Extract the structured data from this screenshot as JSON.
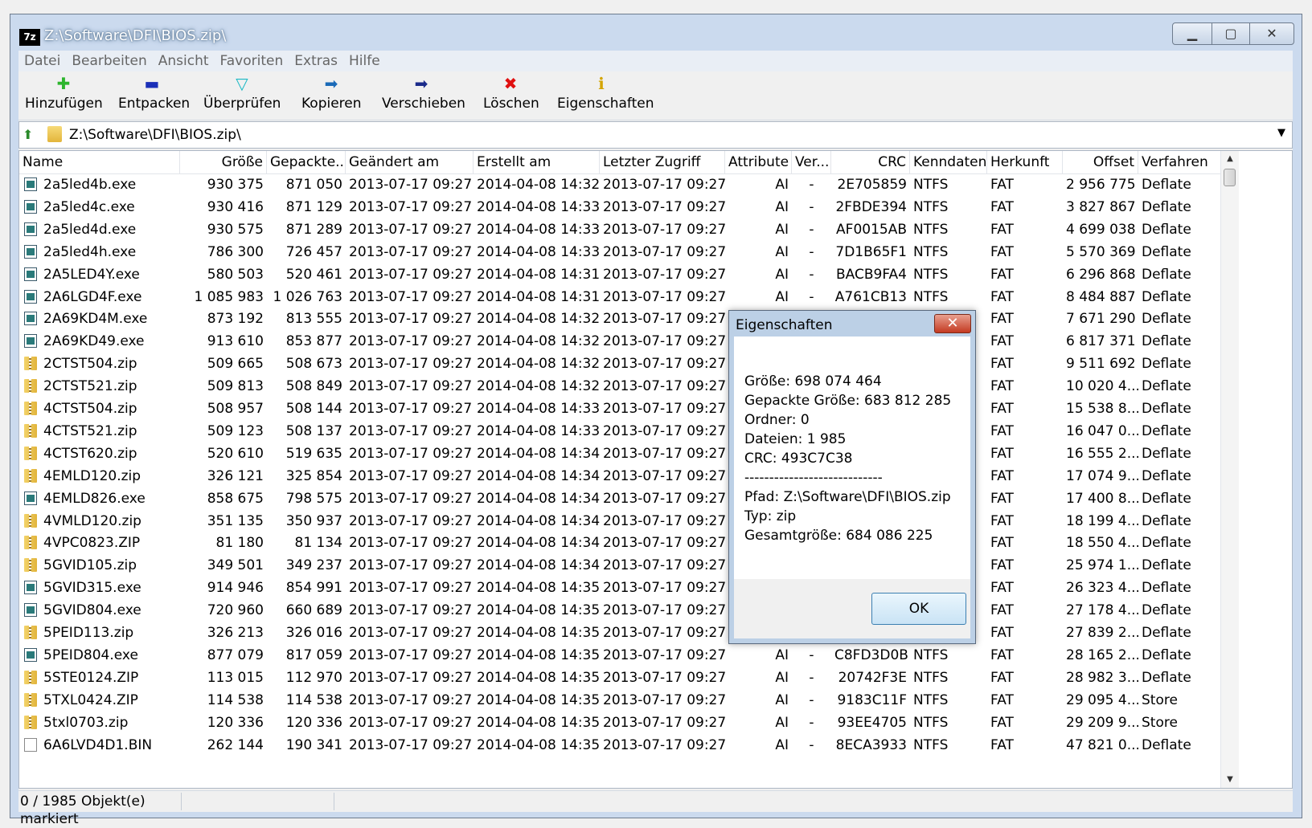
{
  "window": {
    "title": "Z:\\Software\\DFI\\BIOS.zip\\"
  },
  "menu": [
    "Datei",
    "Bearbeiten",
    "Ansicht",
    "Favoriten",
    "Extras",
    "Hilfe"
  ],
  "toolbar": [
    {
      "label": "Hinzufügen",
      "icon": "plus-icon",
      "color": "#2db52d",
      "glyph": "✚"
    },
    {
      "label": "Entpacken",
      "icon": "minus-icon",
      "color": "#1a2fb8",
      "glyph": "▬"
    },
    {
      "label": "Überprüfen",
      "icon": "check-icon",
      "color": "#1ab8c4",
      "glyph": "▽"
    },
    {
      "label": "Kopieren",
      "icon": "copy-arrow-icon",
      "color": "#1a6ab8",
      "glyph": "➡"
    },
    {
      "label": "Verschieben",
      "icon": "move-arrow-icon",
      "color": "#1a2a8a",
      "glyph": "➡"
    },
    {
      "label": "Löschen",
      "icon": "delete-icon",
      "color": "#e01010",
      "glyph": "✖"
    },
    {
      "label": "Eigenschaften",
      "icon": "info-icon",
      "color": "#d4a400",
      "glyph": "ℹ"
    }
  ],
  "address": {
    "path": "Z:\\Software\\DFI\\BIOS.zip\\"
  },
  "columns": [
    "Name",
    "Größe",
    "Gepackte...",
    "Geändert am",
    "Erstellt am",
    "Letzter Zugriff",
    "Attribute",
    "Ver...",
    "CRC",
    "Kenndaten",
    "Herkunft",
    "Offset",
    "Verfahren"
  ],
  "rows": [
    {
      "type": "exe",
      "name": "2a5led4b.exe",
      "size": "930 375",
      "packed": "871 050",
      "modified": "2013-07-17 09:27",
      "created": "2014-04-08 14:32",
      "accessed": "2013-07-17 09:27",
      "attr": "AI",
      "ver": "-",
      "crc": "2E705859",
      "chars": "NTFS",
      "origin": "FAT",
      "offset": "2 956 775",
      "method": "Deflate"
    },
    {
      "type": "exe",
      "name": "2a5led4c.exe",
      "size": "930 416",
      "packed": "871 129",
      "modified": "2013-07-17 09:27",
      "created": "2014-04-08 14:33",
      "accessed": "2013-07-17 09:27",
      "attr": "AI",
      "ver": "-",
      "crc": "2FBDE394",
      "chars": "NTFS",
      "origin": "FAT",
      "offset": "3 827 867",
      "method": "Deflate"
    },
    {
      "type": "exe",
      "name": "2a5led4d.exe",
      "size": "930 575",
      "packed": "871 289",
      "modified": "2013-07-17 09:27",
      "created": "2014-04-08 14:33",
      "accessed": "2013-07-17 09:27",
      "attr": "AI",
      "ver": "-",
      "crc": "AF0015AB",
      "chars": "NTFS",
      "origin": "FAT",
      "offset": "4 699 038",
      "method": "Deflate"
    },
    {
      "type": "exe",
      "name": "2a5led4h.exe",
      "size": "786 300",
      "packed": "726 457",
      "modified": "2013-07-17 09:27",
      "created": "2014-04-08 14:33",
      "accessed": "2013-07-17 09:27",
      "attr": "AI",
      "ver": "-",
      "crc": "7D1B65F1",
      "chars": "NTFS",
      "origin": "FAT",
      "offset": "5 570 369",
      "method": "Deflate"
    },
    {
      "type": "exe",
      "name": "2A5LED4Y.exe",
      "size": "580 503",
      "packed": "520 461",
      "modified": "2013-07-17 09:27",
      "created": "2014-04-08 14:31",
      "accessed": "2013-07-17 09:27",
      "attr": "AI",
      "ver": "-",
      "crc": "BACB9FA4",
      "chars": "NTFS",
      "origin": "FAT",
      "offset": "6 296 868",
      "method": "Deflate"
    },
    {
      "type": "exe",
      "name": "2A6LGD4F.exe",
      "size": "1 085 983",
      "packed": "1 026 763",
      "modified": "2013-07-17 09:27",
      "created": "2014-04-08 14:31",
      "accessed": "2013-07-17 09:27",
      "attr": "AI",
      "ver": "-",
      "crc": "A761CB13",
      "chars": "NTFS",
      "origin": "FAT",
      "offset": "8 484 887",
      "method": "Deflate"
    },
    {
      "type": "exe",
      "name": "2A69KD4M.exe",
      "size": "873 192",
      "packed": "813 555",
      "modified": "2013-07-17 09:27",
      "created": "2014-04-08 14:32",
      "accessed": "2013-07-17 09:27",
      "attr": "",
      "ver": "",
      "crc": "",
      "chars": "",
      "origin": "FAT",
      "offset": "7 671 290",
      "method": "Deflate"
    },
    {
      "type": "exe",
      "name": "2A69KD49.exe",
      "size": "913 610",
      "packed": "853 877",
      "modified": "2013-07-17 09:27",
      "created": "2014-04-08 14:32",
      "accessed": "2013-07-17 09:27",
      "attr": "",
      "ver": "",
      "crc": "",
      "chars": "",
      "origin": "FAT",
      "offset": "6 817 371",
      "method": "Deflate"
    },
    {
      "type": "zip",
      "name": "2CTST504.zip",
      "size": "509 665",
      "packed": "508 673",
      "modified": "2013-07-17 09:27",
      "created": "2014-04-08 14:32",
      "accessed": "2013-07-17 09:27",
      "attr": "",
      "ver": "",
      "crc": "",
      "chars": "",
      "origin": "FAT",
      "offset": "9 511 692",
      "method": "Deflate"
    },
    {
      "type": "zip",
      "name": "2CTST521.zip",
      "size": "509 813",
      "packed": "508 849",
      "modified": "2013-07-17 09:27",
      "created": "2014-04-08 14:32",
      "accessed": "2013-07-17 09:27",
      "attr": "",
      "ver": "",
      "crc": "",
      "chars": "",
      "origin": "FAT",
      "offset": "10 020 4...",
      "method": "Deflate"
    },
    {
      "type": "zip",
      "name": "4CTST504.zip",
      "size": "508 957",
      "packed": "508 144",
      "modified": "2013-07-17 09:27",
      "created": "2014-04-08 14:33",
      "accessed": "2013-07-17 09:27",
      "attr": "",
      "ver": "",
      "crc": "",
      "chars": "",
      "origin": "FAT",
      "offset": "15 538 8...",
      "method": "Deflate"
    },
    {
      "type": "zip",
      "name": "4CTST521.zip",
      "size": "509 123",
      "packed": "508 137",
      "modified": "2013-07-17 09:27",
      "created": "2014-04-08 14:33",
      "accessed": "2013-07-17 09:27",
      "attr": "",
      "ver": "",
      "crc": "",
      "chars": "",
      "origin": "FAT",
      "offset": "16 047 0...",
      "method": "Deflate"
    },
    {
      "type": "zip",
      "name": "4CTST620.zip",
      "size": "520 610",
      "packed": "519 635",
      "modified": "2013-07-17 09:27",
      "created": "2014-04-08 14:34",
      "accessed": "2013-07-17 09:27",
      "attr": "",
      "ver": "",
      "crc": "",
      "chars": "",
      "origin": "FAT",
      "offset": "16 555 2...",
      "method": "Deflate"
    },
    {
      "type": "zip",
      "name": "4EMLD120.zip",
      "size": "326 121",
      "packed": "325 854",
      "modified": "2013-07-17 09:27",
      "created": "2014-04-08 14:34",
      "accessed": "2013-07-17 09:27",
      "attr": "",
      "ver": "",
      "crc": "",
      "chars": "",
      "origin": "FAT",
      "offset": "17 074 9...",
      "method": "Deflate"
    },
    {
      "type": "exe",
      "name": "4EMLD826.exe",
      "size": "858 675",
      "packed": "798 575",
      "modified": "2013-07-17 09:27",
      "created": "2014-04-08 14:34",
      "accessed": "2013-07-17 09:27",
      "attr": "",
      "ver": "",
      "crc": "",
      "chars": "",
      "origin": "FAT",
      "offset": "17 400 8...",
      "method": "Deflate"
    },
    {
      "type": "zip",
      "name": "4VMLD120.zip",
      "size": "351 135",
      "packed": "350 937",
      "modified": "2013-07-17 09:27",
      "created": "2014-04-08 14:34",
      "accessed": "2013-07-17 09:27",
      "attr": "",
      "ver": "",
      "crc": "",
      "chars": "",
      "origin": "FAT",
      "offset": "18 199 4...",
      "method": "Deflate"
    },
    {
      "type": "zip",
      "name": "4VPC0823.ZIP",
      "size": "81 180",
      "packed": "81 134",
      "modified": "2013-07-17 09:27",
      "created": "2014-04-08 14:34",
      "accessed": "2013-07-17 09:27",
      "attr": "",
      "ver": "",
      "crc": "",
      "chars": "",
      "origin": "FAT",
      "offset": "18 550 4...",
      "method": "Deflate"
    },
    {
      "type": "zip",
      "name": "5GVID105.zip",
      "size": "349 501",
      "packed": "349 237",
      "modified": "2013-07-17 09:27",
      "created": "2014-04-08 14:34",
      "accessed": "2013-07-17 09:27",
      "attr": "",
      "ver": "",
      "crc": "",
      "chars": "",
      "origin": "FAT",
      "offset": "25 974 1...",
      "method": "Deflate"
    },
    {
      "type": "exe",
      "name": "5GVID315.exe",
      "size": "914 946",
      "packed": "854 991",
      "modified": "2013-07-17 09:27",
      "created": "2014-04-08 14:35",
      "accessed": "2013-07-17 09:27",
      "attr": "",
      "ver": "",
      "crc": "",
      "chars": "",
      "origin": "FAT",
      "offset": "26 323 4...",
      "method": "Deflate"
    },
    {
      "type": "exe",
      "name": "5GVID804.exe",
      "size": "720 960",
      "packed": "660 689",
      "modified": "2013-07-17 09:27",
      "created": "2014-04-08 14:35",
      "accessed": "2013-07-17 09:27",
      "attr": "",
      "ver": "",
      "crc": "",
      "chars": "",
      "origin": "FAT",
      "offset": "27 178 4...",
      "method": "Deflate"
    },
    {
      "type": "zip",
      "name": "5PEID113.zip",
      "size": "326 213",
      "packed": "326 016",
      "modified": "2013-07-17 09:27",
      "created": "2014-04-08 14:35",
      "accessed": "2013-07-17 09:27",
      "attr": "",
      "ver": "",
      "crc": "",
      "chars": "",
      "origin": "FAT",
      "offset": "27 839 2...",
      "method": "Deflate"
    },
    {
      "type": "exe",
      "name": "5PEID804.exe",
      "size": "877 079",
      "packed": "817 059",
      "modified": "2013-07-17 09:27",
      "created": "2014-04-08 14:35",
      "accessed": "2013-07-17 09:27",
      "attr": "AI",
      "ver": "-",
      "crc": "C8FD3D0B",
      "chars": "NTFS",
      "origin": "FAT",
      "offset": "28 165 2...",
      "method": "Deflate"
    },
    {
      "type": "zip",
      "name": "5STE0124.ZIP",
      "size": "113 015",
      "packed": "112 970",
      "modified": "2013-07-17 09:27",
      "created": "2014-04-08 14:35",
      "accessed": "2013-07-17 09:27",
      "attr": "AI",
      "ver": "-",
      "crc": "20742F3E",
      "chars": "NTFS",
      "origin": "FAT",
      "offset": "28 982 3...",
      "method": "Deflate"
    },
    {
      "type": "zip",
      "name": "5TXL0424.ZIP",
      "size": "114 538",
      "packed": "114 538",
      "modified": "2013-07-17 09:27",
      "created": "2014-04-08 14:35",
      "accessed": "2013-07-17 09:27",
      "attr": "AI",
      "ver": "-",
      "crc": "9183C11F",
      "chars": "NTFS",
      "origin": "FAT",
      "offset": "29 095 4...",
      "method": "Store"
    },
    {
      "type": "zip",
      "name": "5txl0703.zip",
      "size": "120 336",
      "packed": "120 336",
      "modified": "2013-07-17 09:27",
      "created": "2014-04-08 14:35",
      "accessed": "2013-07-17 09:27",
      "attr": "AI",
      "ver": "-",
      "crc": "93EE4705",
      "chars": "NTFS",
      "origin": "FAT",
      "offset": "29 209 9...",
      "method": "Store"
    },
    {
      "type": "bin",
      "name": "6A6LVD4D1.BIN",
      "size": "262 144",
      "packed": "190 341",
      "modified": "2013-07-17 09:27",
      "created": "2014-04-08 14:35",
      "accessed": "2013-07-17 09:27",
      "attr": "AI",
      "ver": "-",
      "crc": "8ECA3933",
      "chars": "NTFS",
      "origin": "FAT",
      "offset": "47 821 0...",
      "method": "Deflate"
    }
  ],
  "status": {
    "selection": "0 / 1985 Objekt(e) markiert"
  },
  "dialog": {
    "title": "Eigenschaften",
    "lines": [
      "Größe: 698 074 464",
      "Gepackte Größe: 683 812 285",
      "Ordner: 0",
      "Dateien: 1 985",
      "CRC: 493C7C38",
      "----------------------------",
      "Pfad: Z:\\Software\\DFI\\BIOS.zip",
      "Typ: zip",
      "Gesamtgröße: 684 086 225"
    ],
    "ok_label": "OK"
  }
}
